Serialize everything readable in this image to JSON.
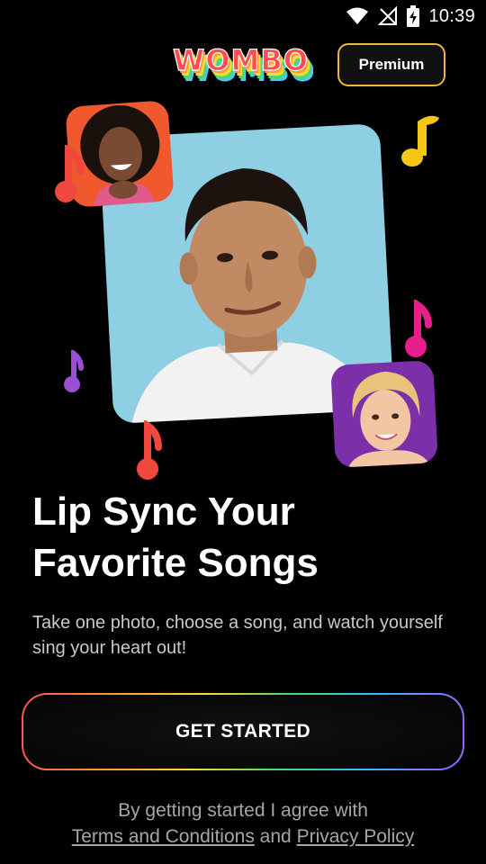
{
  "status_bar": {
    "time": "10:39",
    "icons": [
      "wifi-icon",
      "no-signal-icon",
      "battery-charging-icon"
    ]
  },
  "header": {
    "logo_text": "WOMBO",
    "premium_label": "Premium"
  },
  "colors": {
    "premium_border": "#e8b83a",
    "main_card_bg": "#8fcfe3",
    "side_card_1_bg": "#f0592e",
    "side_card_2_bg": "#7b2fa8",
    "note_yellow": "#f5c518",
    "note_pink": "#e91e8c",
    "note_purple": "#9b4fd6",
    "note_red": "#f0473e"
  },
  "headline": {
    "line1": "Lip Sync Your",
    "line2": "Favorite Songs"
  },
  "subtext": "Take one photo, choose a song, and watch yourself sing your heart out!",
  "cta_label": "GET STARTED",
  "legal": {
    "prefix": "By getting started I agree with",
    "terms_link": "Terms and Conditions",
    "conjunction": "and",
    "privacy_link": "Privacy Policy"
  }
}
